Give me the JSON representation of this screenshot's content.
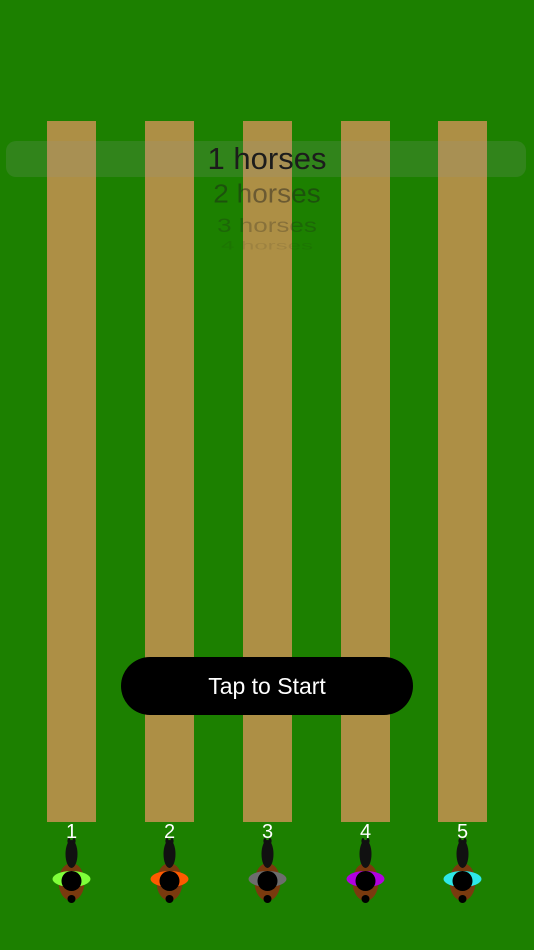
{
  "picker": {
    "options": [
      "1 horses",
      "2 horses",
      "3 horses",
      "4 horses"
    ],
    "selected": "1 horses"
  },
  "start_button": {
    "label": "Tap to Start"
  },
  "lanes": [
    {
      "number": "1",
      "jockey_color": "#7fff3a"
    },
    {
      "number": "2",
      "jockey_color": "#ff5a00"
    },
    {
      "number": "3",
      "jockey_color": "#6d6d6d"
    },
    {
      "number": "4",
      "jockey_color": "#b200e0"
    },
    {
      "number": "5",
      "jockey_color": "#2ee8e8"
    }
  ],
  "colors": {
    "grass": "#1c8000",
    "track": "#ad8f45",
    "horse": "#7a3a0e",
    "button": "#000000"
  }
}
